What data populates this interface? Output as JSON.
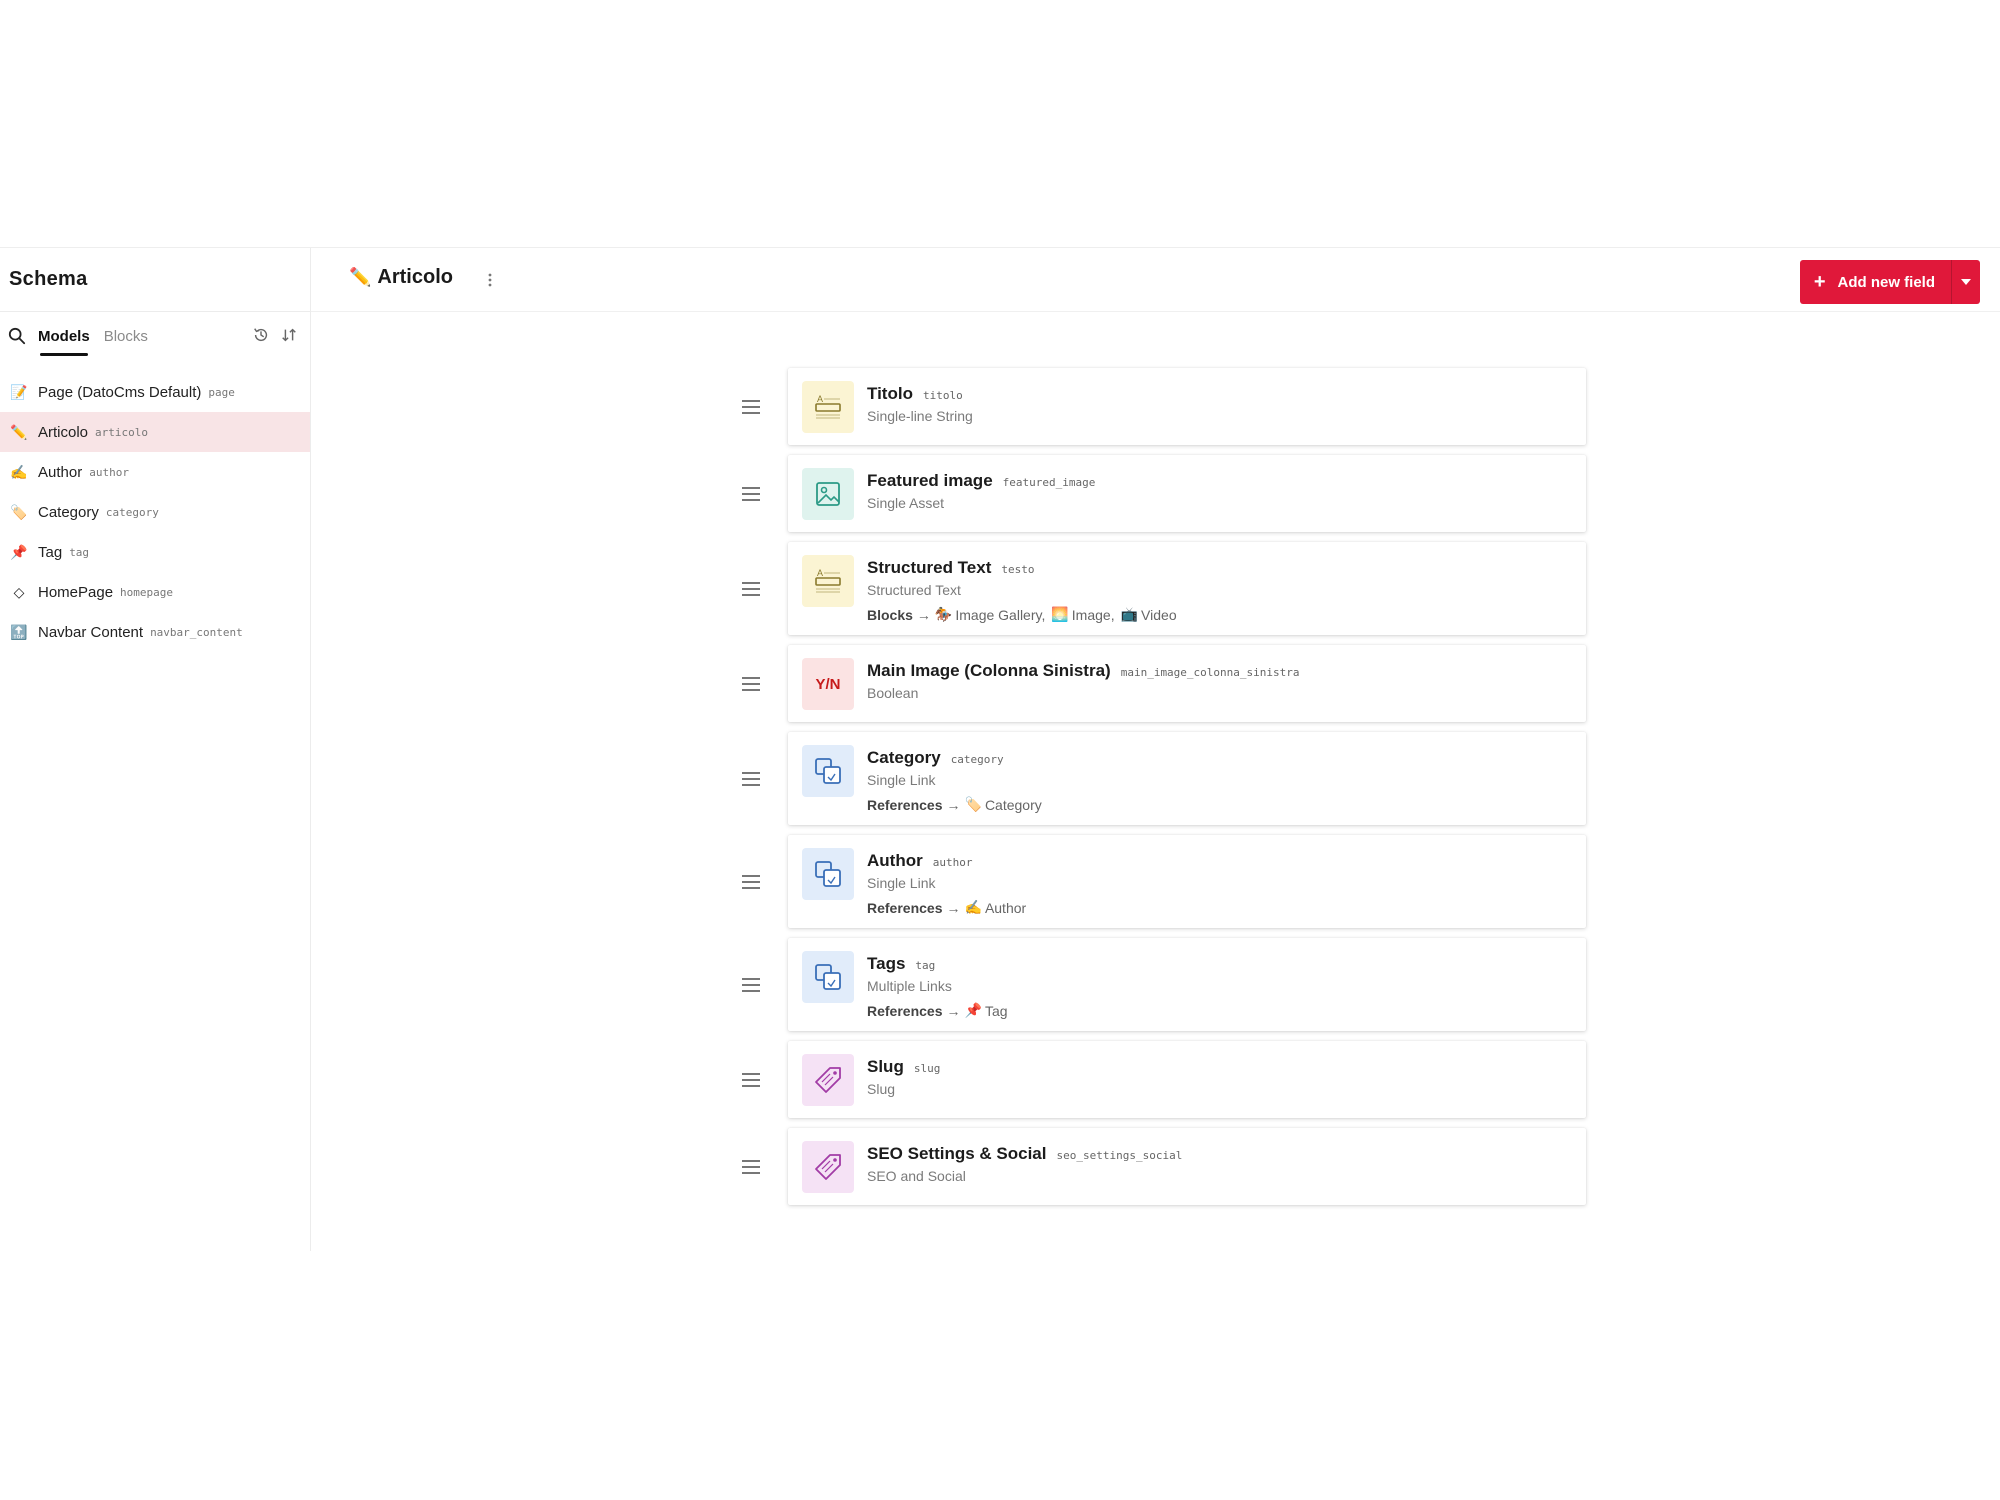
{
  "sidebar": {
    "title": "Schema",
    "tabs": [
      {
        "label": "Models",
        "active": true
      },
      {
        "label": "Blocks",
        "active": false
      }
    ],
    "models": [
      {
        "emoji": "📝",
        "name": "Page (DatoCms Default)",
        "key": "page"
      },
      {
        "emoji": "✏️",
        "name": "Articolo",
        "key": "articolo",
        "selected": true
      },
      {
        "emoji": "✍️",
        "name": "Author",
        "key": "author"
      },
      {
        "emoji": "🏷️",
        "name": "Category",
        "key": "category"
      },
      {
        "emoji": "📌",
        "name": "Tag",
        "key": "tag"
      },
      {
        "emoji": "◇",
        "name": "HomePage",
        "key": "homepage"
      },
      {
        "emoji": "🔝",
        "name": "Navbar Content",
        "key": "navbar_content"
      }
    ]
  },
  "header": {
    "emoji": "✏️",
    "title": "Articolo",
    "add_button": "Add new field"
  },
  "fields": [
    {
      "label": "Titolo",
      "key": "titolo",
      "type": "Single-line String",
      "icon": "text-field-icon",
      "bg": "#fbf4d3",
      "fg": "#8a7a2c"
    },
    {
      "label": "Featured image",
      "key": "featured_image",
      "type": "Single Asset",
      "icon": "image-icon",
      "bg": "#dff3ee",
      "fg": "#2c9a86"
    },
    {
      "label": "Structured Text",
      "key": "testo",
      "type": "Structured Text",
      "icon": "text-field-icon",
      "bg": "#fbf4d3",
      "fg": "#8a7a2c",
      "extra_kw": "Blocks",
      "extra_items": [
        {
          "emoji": "🏇",
          "label": "Image Gallery,"
        },
        {
          "emoji": "🌅",
          "label": "Image,"
        },
        {
          "emoji": "📺",
          "label": "Video"
        }
      ]
    },
    {
      "label": "Main Image (Colonna Sinistra)",
      "key": "main_image_colonna_sinistra",
      "type": "Boolean",
      "icon": "boolean-icon",
      "bg": "#fbe3e3",
      "fg": "#c61a1a",
      "badge": "Y/N"
    },
    {
      "label": "Category",
      "key": "category",
      "type": "Single Link",
      "icon": "link-icon",
      "bg": "#e1ecfa",
      "fg": "#3a6fb8",
      "extra_kw": "References",
      "extra_items": [
        {
          "emoji": "🏷️",
          "label": "Category"
        }
      ]
    },
    {
      "label": "Author",
      "key": "author",
      "type": "Single Link",
      "icon": "link-icon",
      "bg": "#e1ecfa",
      "fg": "#3a6fb8",
      "extra_kw": "References",
      "extra_items": [
        {
          "emoji": "✍️",
          "label": "Author"
        }
      ]
    },
    {
      "label": "Tags",
      "key": "tag",
      "type": "Multiple Links",
      "icon": "link-icon",
      "bg": "#e1ecfa",
      "fg": "#3a6fb8",
      "extra_kw": "References",
      "extra_items": [
        {
          "emoji": "📌",
          "label": "Tag"
        }
      ]
    },
    {
      "label": "Slug",
      "key": "slug",
      "type": "Slug",
      "icon": "seo-tag-icon",
      "bg": "#f5e2f5",
      "fg": "#a23ca6"
    },
    {
      "label": "SEO Settings & Social",
      "key": "seo_settings_social",
      "type": "SEO and Social",
      "icon": "seo-tag-icon",
      "bg": "#f5e2f5",
      "fg": "#a23ca6"
    }
  ],
  "colors": {
    "accent": "#e0183a",
    "selected_bg": "#f8e4e6"
  }
}
